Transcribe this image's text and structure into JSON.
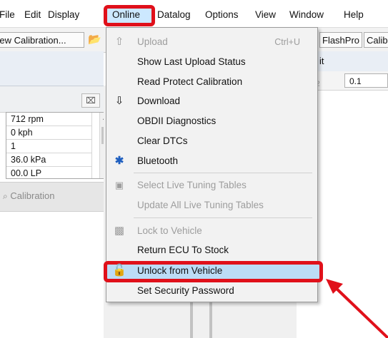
{
  "menubar": {
    "items": [
      {
        "label": "File"
      },
      {
        "label": "Edit"
      },
      {
        "label": "Display"
      },
      {
        "label": "Online"
      },
      {
        "label": "Datalog"
      },
      {
        "label": "Options"
      },
      {
        "label": "View"
      },
      {
        "label": "Window"
      },
      {
        "label": "Help"
      }
    ]
  },
  "toolbar": {
    "new_calibration": "New Calibration...",
    "flashpro": "FlashPro",
    "calib": "Calib"
  },
  "sensor_values": [
    "712 rpm",
    "0 kph",
    "1",
    "36.0 kPa",
    "00.0 LP"
  ],
  "calibration_tab": "Calibration",
  "right_panel": {
    "header": "it",
    "step_value": "0.1"
  },
  "online_menu": {
    "items": [
      {
        "label": "Upload",
        "shortcut": "Ctrl+U",
        "icon": "upload-arrow-icon",
        "disabled": true
      },
      {
        "label": "Show Last Upload Status",
        "disabled": false
      },
      {
        "label": "Read Protect Calibration",
        "disabled": false
      },
      {
        "label": "Download",
        "icon": "download-arrow-icon",
        "disabled": false
      },
      {
        "label": "OBDII Diagnostics",
        "disabled": false
      },
      {
        "label": "Clear DTCs",
        "disabled": false
      },
      {
        "label": "Bluetooth",
        "icon": "bluetooth-icon",
        "disabled": false
      },
      {
        "label": "Select Live Tuning Tables",
        "icon": "tables-icon",
        "disabled": true
      },
      {
        "label": "Update All Live Tuning Tables",
        "disabled": true
      },
      {
        "label": "Lock to Vehicle",
        "icon": "lock-icon",
        "disabled": true
      },
      {
        "label": "Return ECU To Stock",
        "disabled": false
      },
      {
        "label": "Unlock from Vehicle",
        "icon": "unlock-icon",
        "disabled": false,
        "highlighted": true
      },
      {
        "label": "Set Security Password",
        "disabled": false
      }
    ]
  },
  "colors": {
    "highlight_red": "#e0101a",
    "menu_selection": "#cce8ff",
    "item_selection": "#bcdcf6",
    "bluetooth": "#1f5fbf"
  }
}
